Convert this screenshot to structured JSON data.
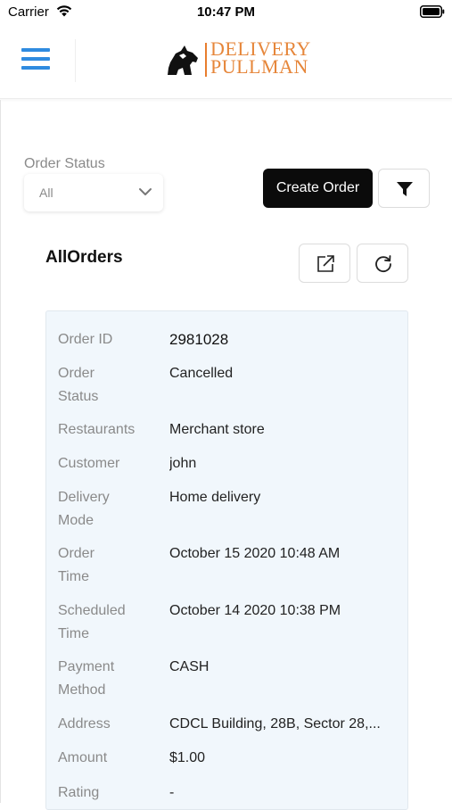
{
  "status_bar": {
    "carrier": "Carrier",
    "time": "10:47 PM"
  },
  "header": {
    "logo_line1": "DELIVERY",
    "logo_line2": "PULLMAN",
    "logo_color": "#e6863a",
    "menu_color": "#2f8be0",
    "menu_icon": "hamburger-menu-icon"
  },
  "filters": {
    "order_status_label": "Order Status",
    "order_status_value": "All",
    "create_order_label": "Create Order",
    "filter_icon": "filter-funnel-icon"
  },
  "orders": {
    "title": "AllOrders",
    "export_icon": "external-link-icon",
    "refresh_icon": "refresh-icon",
    "card": {
      "labels": {
        "order_id": [
          "Order ID"
        ],
        "order_status": [
          "Order",
          "Status"
        ],
        "restaurants": [
          "Restaurants"
        ],
        "customer": [
          "Customer"
        ],
        "delivery_mode": [
          "Delivery",
          "Mode"
        ],
        "order_time": [
          "Order",
          "Time"
        ],
        "scheduled_time": [
          "Scheduled",
          "Time"
        ],
        "payment_method": [
          "Payment",
          "Method"
        ],
        "address": [
          "Address"
        ],
        "amount": [
          "Amount"
        ],
        "rating": [
          "Rating"
        ]
      },
      "values": {
        "order_id": "2981028",
        "order_status": "Cancelled",
        "restaurants": "Merchant store",
        "customer": "john",
        "delivery_mode": "Home delivery",
        "order_time": "October 15 2020 10:48 AM",
        "scheduled_time": "October 14 2020 10:38 PM",
        "payment_method": "CASH",
        "address": "CDCL Building, 28B, Sector 28,...",
        "amount": "$1.00",
        "rating": "-"
      }
    }
  },
  "colors": {
    "primary_button": "#0b0b0b",
    "card_background": "#f1f7fc"
  }
}
